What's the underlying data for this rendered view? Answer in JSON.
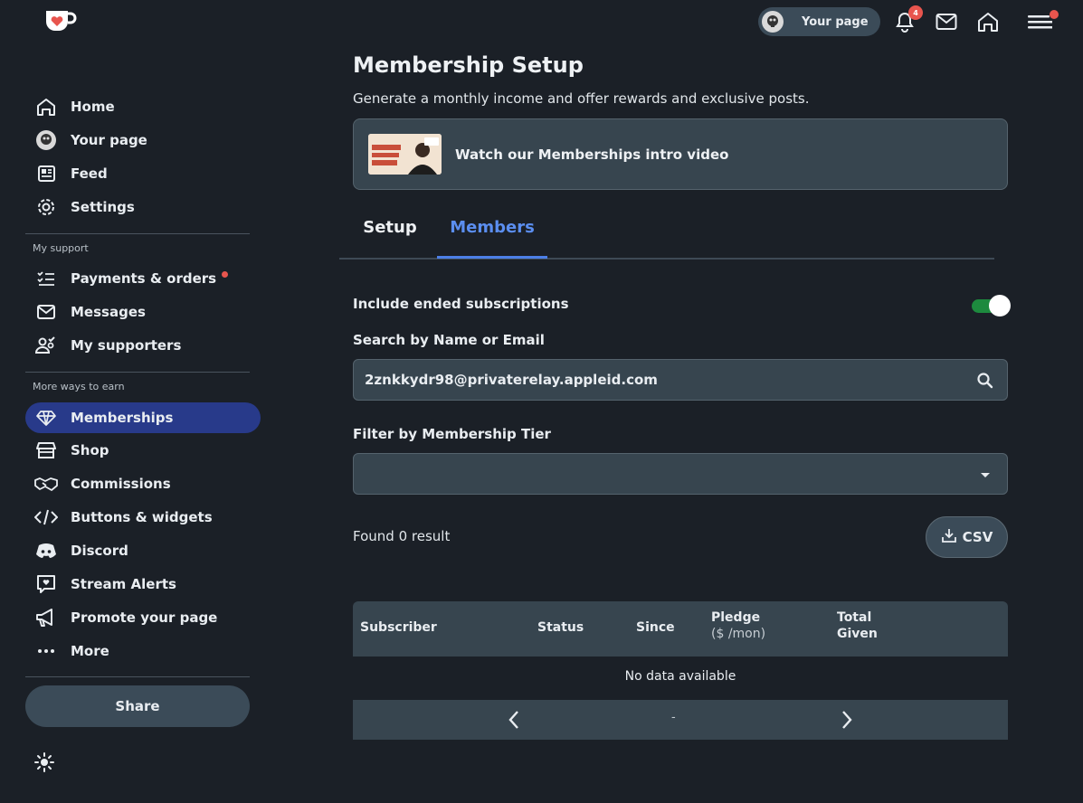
{
  "topbar": {
    "your_page_label": "Your page",
    "notification_count": "4"
  },
  "sidebar": {
    "items_main": [
      {
        "label": "Home",
        "icon": "home-icon"
      },
      {
        "label": "Your page",
        "icon": "avatar"
      },
      {
        "label": "Feed",
        "icon": "feed-icon"
      },
      {
        "label": "Settings",
        "icon": "gear-icon"
      }
    ],
    "section_support": "My support",
    "items_support": [
      {
        "label": "Payments & orders",
        "icon": "checklist-icon"
      },
      {
        "label": "Messages",
        "icon": "mail-icon"
      },
      {
        "label": "My supporters",
        "icon": "supporters-icon"
      }
    ],
    "section_earn": "More ways to earn",
    "items_earn": [
      {
        "label": "Memberships",
        "icon": "diamond-icon"
      },
      {
        "label": "Shop",
        "icon": "shop-icon"
      },
      {
        "label": "Commissions",
        "icon": "handshake-icon"
      },
      {
        "label": "Buttons & widgets",
        "icon": "code-icon"
      },
      {
        "label": "Discord",
        "icon": "discord-icon"
      },
      {
        "label": "Stream Alerts",
        "icon": "alert-icon"
      },
      {
        "label": "Promote your page",
        "icon": "megaphone-icon"
      },
      {
        "label": "More",
        "icon": "more-icon"
      }
    ],
    "share_label": "Share"
  },
  "main": {
    "title": "Membership Setup",
    "subtitle": "Generate a monthly income and offer rewards and exclusive posts.",
    "video_label": "Watch our Memberships intro video",
    "tabs": [
      {
        "label": "Setup",
        "active": false
      },
      {
        "label": "Members",
        "active": true
      }
    ],
    "include_ended_label": "Include ended subscriptions",
    "include_ended_on": true,
    "search_label": "Search by Name or Email",
    "search_value": "2znkkydr98@privaterelay.appleid.com",
    "filter_label": "Filter by Membership Tier",
    "filter_value": "",
    "found_text": "Found 0 result",
    "csv_label": "CSV",
    "table": {
      "headers": [
        "Subscriber",
        "Status",
        "Since",
        "Pledge",
        "Total"
      ],
      "header_subs": {
        "pledge": "($ /mon)",
        "total": "Given"
      },
      "empty_text": "No data available",
      "page_text": "-"
    }
  },
  "colors": {
    "background": "#1b2027",
    "accent": "#4c7fe6",
    "active_nav": "#283a8a",
    "toggle_on": "#1d8a3e",
    "badge": "#e8554e"
  }
}
